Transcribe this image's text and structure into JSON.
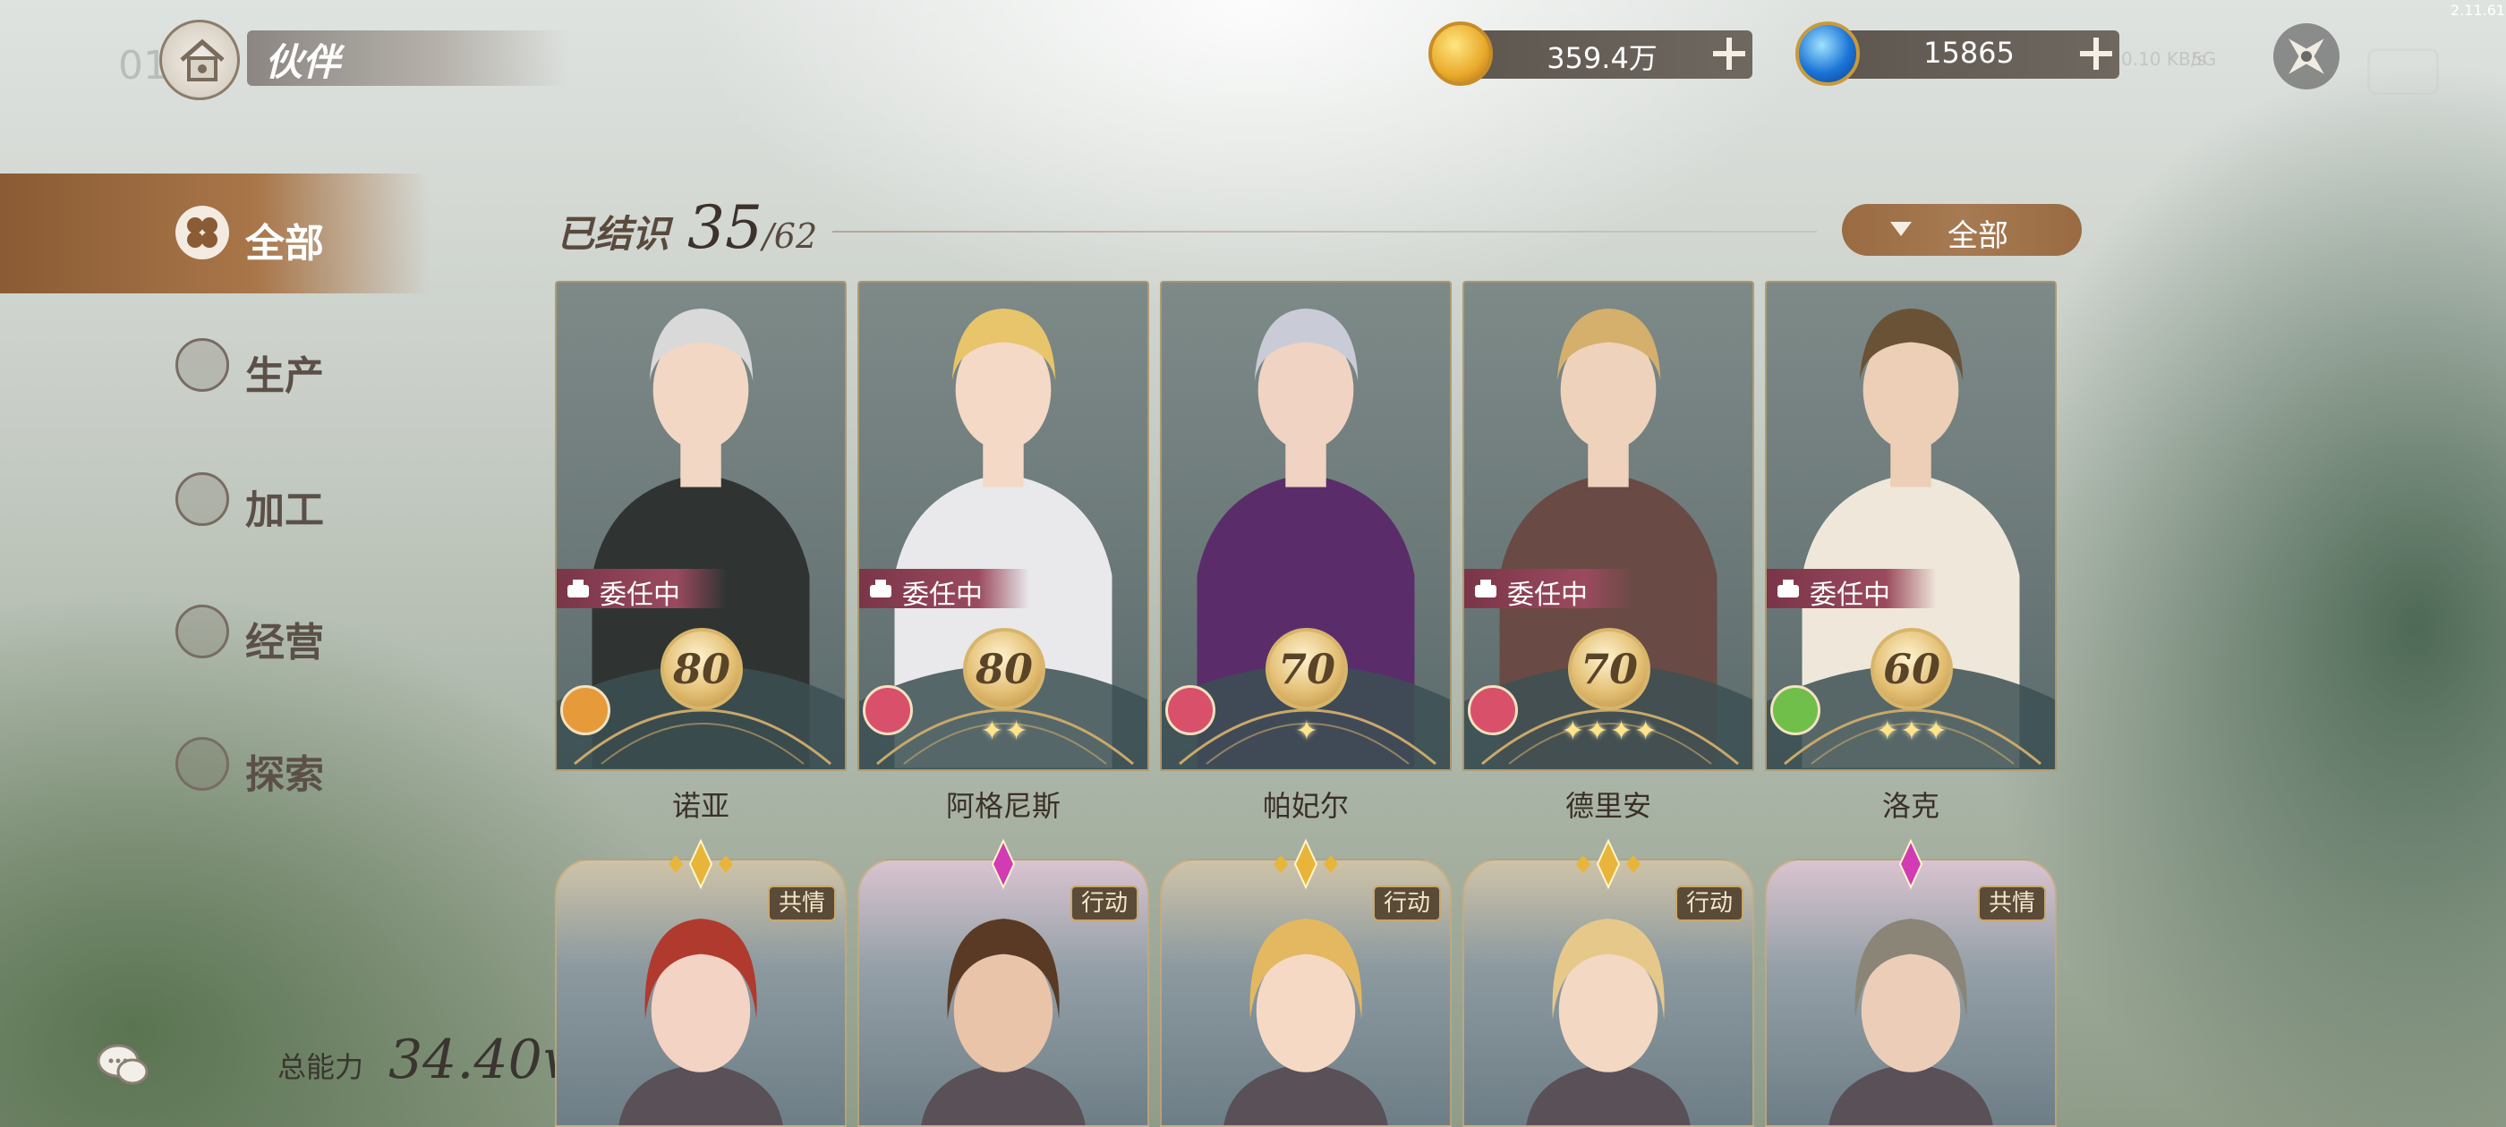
{
  "version": "2.11.61",
  "header": {
    "title": "伙伴",
    "clock": "01",
    "gold_value": "359.4万",
    "gem_value": "15865",
    "network_speed": "0.10\nKB/s",
    "network_type": "5G"
  },
  "sidebar": {
    "items": [
      {
        "label": "全部",
        "active": true
      },
      {
        "label": "生产",
        "active": false
      },
      {
        "label": "加工",
        "active": false
      },
      {
        "label": "经营",
        "active": false
      },
      {
        "label": "探索",
        "active": false
      }
    ],
    "power_label": "总能力",
    "power_value": "34.40w"
  },
  "main": {
    "known_label": "已结识",
    "known_count": "35",
    "known_total": "/62",
    "filter_label": "全部",
    "cards": [
      {
        "name": "诺亚",
        "level": "80",
        "assigned": true,
        "assign_label": "委任中",
        "stars": "",
        "job_color": "#e79a3a"
      },
      {
        "name": "阿格尼斯",
        "level": "80",
        "assigned": true,
        "assign_label": "委任中",
        "stars": "✦✦",
        "job_color": "#d9506a"
      },
      {
        "name": "帕妃尔",
        "level": "70",
        "assigned": false,
        "assign_label": "",
        "stars": "✦",
        "job_color": "#d9506a"
      },
      {
        "name": "德里安",
        "level": "70",
        "assigned": true,
        "assign_label": "委任中",
        "stars": "✦✦✦✦",
        "job_color": "#d9506a"
      },
      {
        "name": "洛克",
        "level": "60",
        "assigned": true,
        "assign_label": "委任中",
        "stars": "✦✦✦",
        "job_color": "#6fbf4a"
      }
    ],
    "cards_row2": [
      {
        "tag": "共情",
        "gem": "gold"
      },
      {
        "tag": "行动",
        "gem": "pink"
      },
      {
        "tag": "行动",
        "gem": "gold"
      },
      {
        "tag": "行动",
        "gem": "gold"
      },
      {
        "tag": "共情",
        "gem": "pink"
      }
    ]
  }
}
